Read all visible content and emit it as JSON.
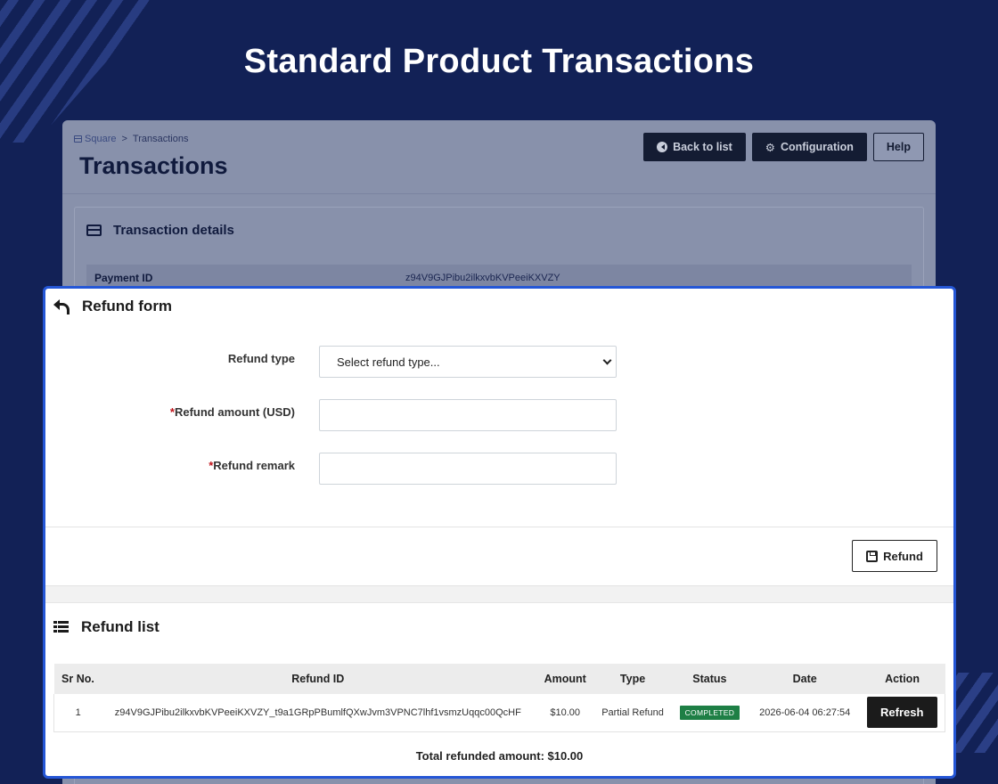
{
  "hero": {
    "title": "Standard Product Transactions"
  },
  "admin": {
    "breadcrumb": {
      "root": "Square",
      "separator": ">",
      "current": "Transactions"
    },
    "title": "Transactions",
    "buttons": {
      "back": "Back to list",
      "config": "Configuration",
      "help": "Help"
    },
    "details": {
      "heading": "Transaction details",
      "payment_id_label": "Payment ID",
      "payment_id_value": "z94V9GJPibu2ilkxvbKVPeeiKXVZY"
    }
  },
  "refund_form": {
    "heading": "Refund form",
    "type_label": "Refund type",
    "type_value": "Select refund type...",
    "amount_label": "Refund amount (USD)",
    "amount_value": "",
    "remark_label": "Refund remark",
    "remark_value": "",
    "required_mark": "*",
    "submit_label": "Refund"
  },
  "refund_list": {
    "heading": "Refund list",
    "columns": [
      "Sr No.",
      "Refund ID",
      "Amount",
      "Type",
      "Status",
      "Date",
      "Action"
    ],
    "rows": [
      {
        "sr": "1",
        "refund_id": "z94V9GJPibu2ilkxvbKVPeeiKXVZY_t9a1GRpPBumlfQXwJvm3VPNC7lhf1vsmzUqqc00QcHF",
        "amount": "$10.00",
        "type": "Partial Refund",
        "status": "COMPLETED",
        "date": "2026-06-04 06:27:54",
        "action": "Refresh"
      }
    ],
    "total": "Total refunded amount: $10.00"
  },
  "colors": {
    "background": "#122156",
    "modal_border": "#2456d6",
    "status_completed": "#1e7f45",
    "required": "#c0141b"
  }
}
